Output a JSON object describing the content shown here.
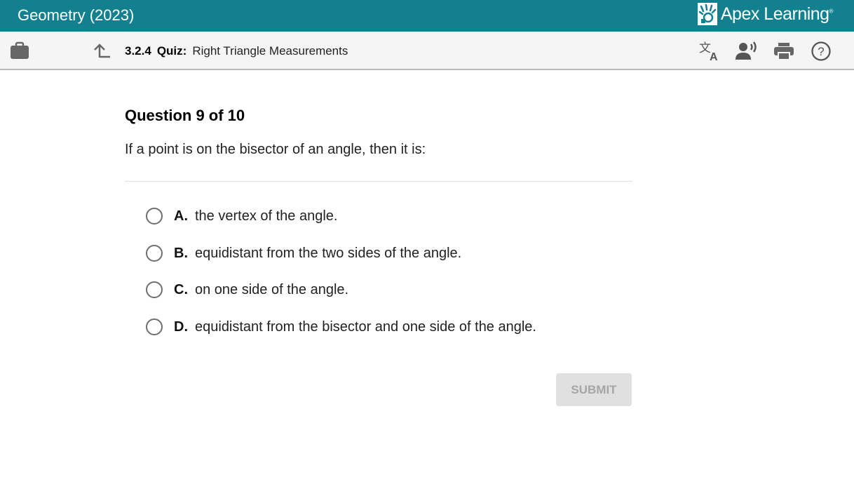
{
  "header": {
    "course_title": "Geometry (2023)",
    "brand": "Apex Learning",
    "brand_mark": "®"
  },
  "toolbar": {
    "breadcrumb_number": "3.2.4",
    "breadcrumb_type": "Quiz:",
    "breadcrumb_title": "Right Triangle Measurements",
    "icons": [
      "briefcase-icon",
      "up-arrow-icon",
      "translate-icon",
      "read-aloud-icon",
      "print-icon",
      "help-icon"
    ]
  },
  "question": {
    "title": "Question 9 of 10",
    "prompt": "If a point is on the bisector of an angle, then it is:",
    "options": [
      {
        "letter": "A.",
        "text": "the vertex of the angle."
      },
      {
        "letter": "B.",
        "text": "equidistant from the two sides of the angle."
      },
      {
        "letter": "C.",
        "text": "on one side of the angle."
      },
      {
        "letter": "D.",
        "text": "equidistant from the bisector and one side of the angle."
      }
    ],
    "submit_label": "SUBMIT"
  }
}
